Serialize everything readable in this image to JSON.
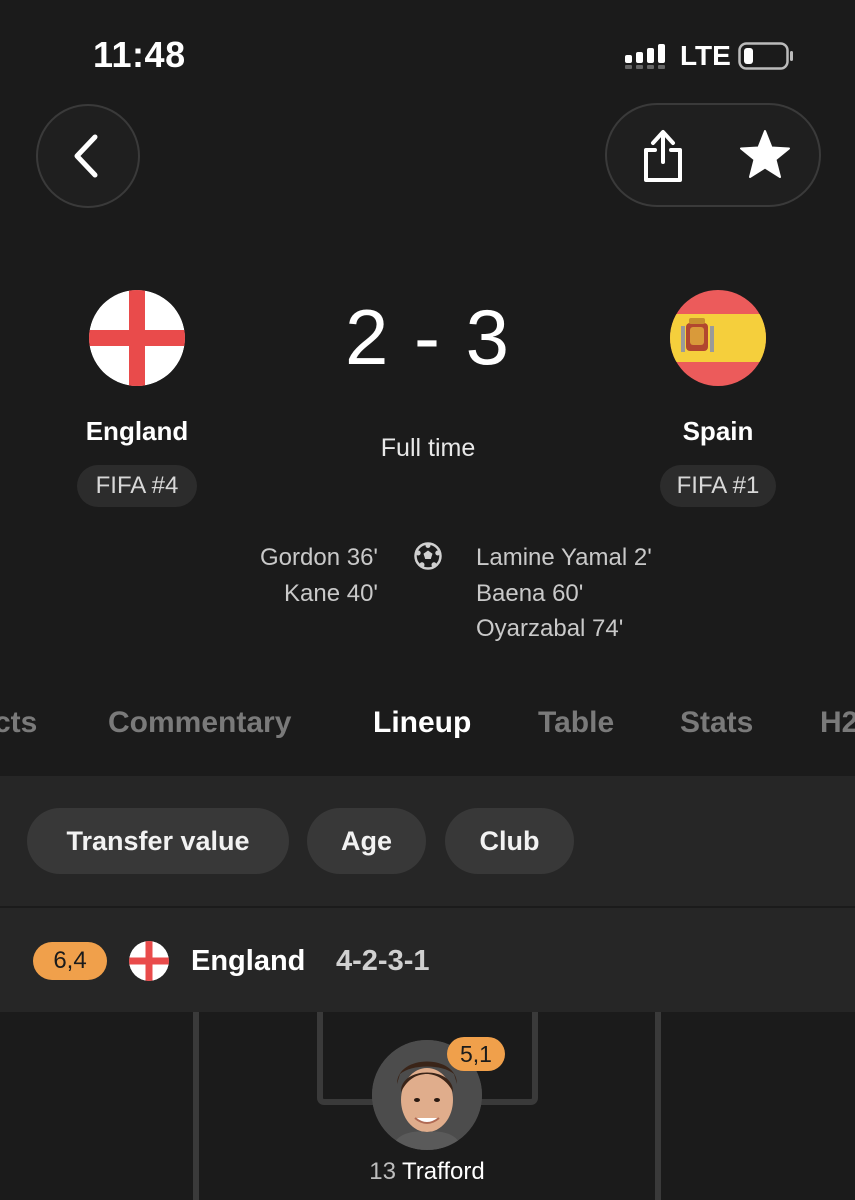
{
  "status_bar": {
    "time": "11:48",
    "network": "LTE",
    "icons": [
      "signal-icon",
      "battery-icon"
    ]
  },
  "header": {
    "icons": [
      "back-chevron-icon",
      "share-icon",
      "star-icon"
    ]
  },
  "match": {
    "home": {
      "name": "England",
      "rank": "FIFA #4",
      "flag": "england-flag-icon"
    },
    "away": {
      "name": "Spain",
      "rank": "FIFA #1",
      "flag": "spain-flag-icon"
    },
    "score": "2 - 3",
    "status": "Full time",
    "home_scorers": [
      "Gordon 36'",
      "Kane 40'"
    ],
    "away_scorers": [
      "Lamine Yamal 2'",
      "Baena 60'",
      "Oyarzabal 74'"
    ]
  },
  "tabs": [
    "cts",
    "Commentary",
    "Lineup",
    "Table",
    "Stats",
    "H2"
  ],
  "active_tab": "Lineup",
  "filters": [
    "Transfer value",
    "Age",
    "Club"
  ],
  "lineup": {
    "team_rating": "6,4",
    "team_name": "England",
    "formation": "4-2-3-1",
    "player": {
      "rating": "5,1",
      "number": "13",
      "name": "Trafford"
    }
  },
  "colors": {
    "rating_badge": "#f0a04b",
    "background": "#1b1b1b",
    "panel": "#262626",
    "chip": "#383838"
  }
}
